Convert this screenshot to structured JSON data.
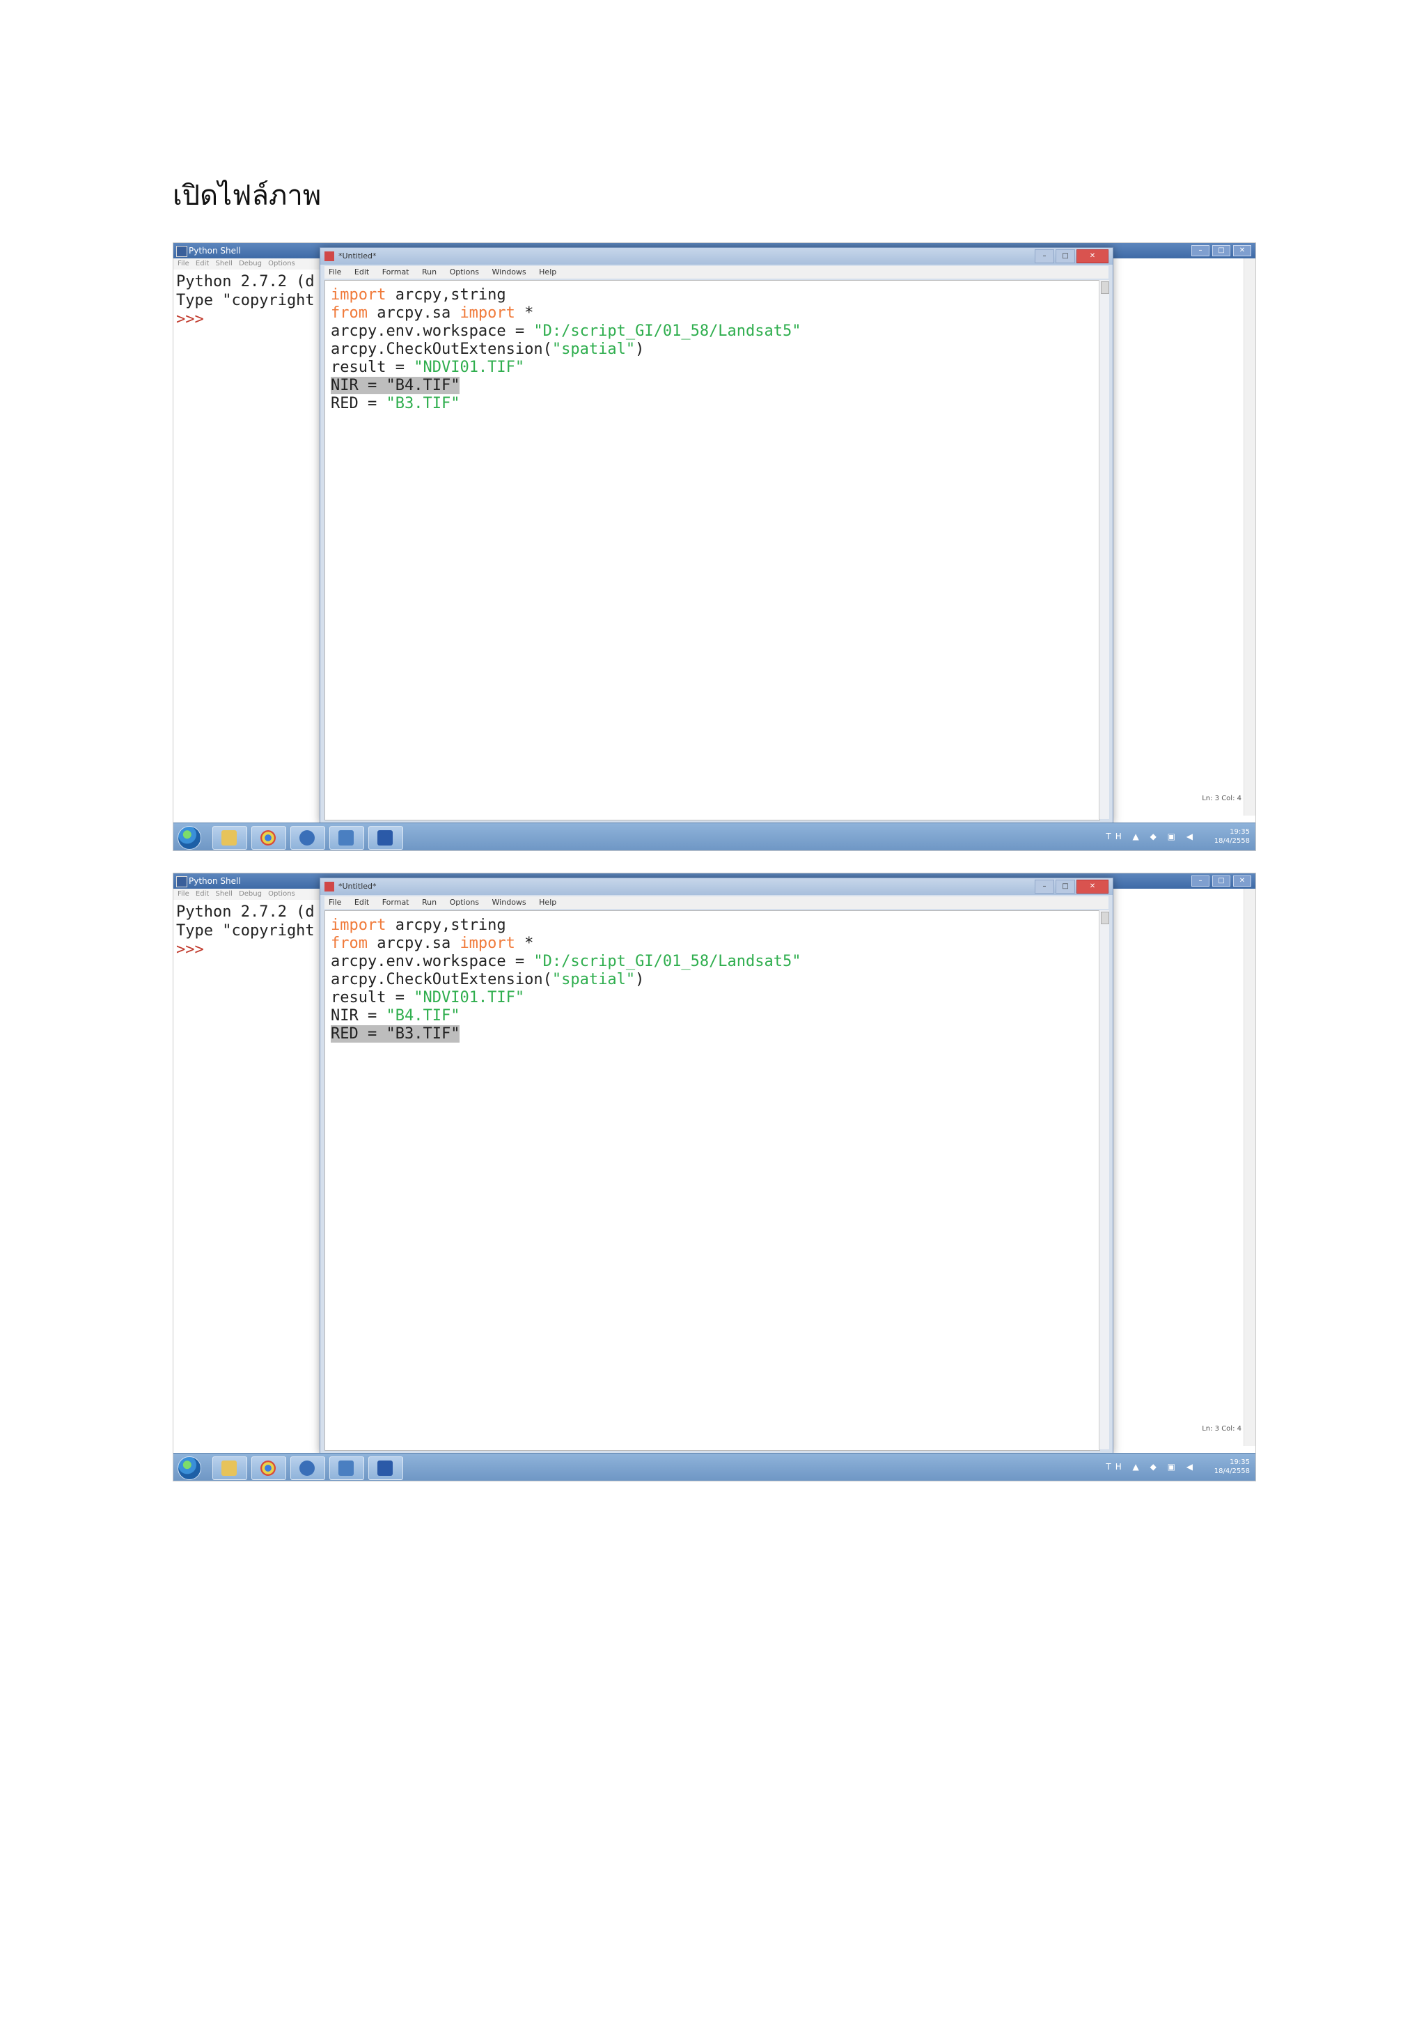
{
  "heading": "เปิดไฟล์ภาพ",
  "shell": {
    "title": "Python Shell",
    "menu": [
      "File",
      "Edit",
      "Shell",
      "Debug",
      "Options"
    ],
    "lines": [
      "Python 2.7.2 (d",
      "Type \"copyright"
    ],
    "prompt": ">>>",
    "status": "Ln: 3 Col: 4"
  },
  "editor": {
    "title": "*Untitled*",
    "menu": [
      "File",
      "Edit",
      "Format",
      "Run",
      "Options",
      "Windows",
      "Help"
    ],
    "code": {
      "l1_kw": "import",
      "l1_rest": " arcpy,string",
      "l2_kw1": "from",
      "l2_mid": " arcpy.sa ",
      "l2_kw2": "import",
      "l2_rest": " *",
      "l3_pre": "arcpy.env.workspace = ",
      "l3_str": "\"D:/script_GI/01_58/Landsat5\"",
      "l4_pre": "arcpy.CheckOutExtension(",
      "l4_str": "\"spatial\"",
      "l4_post": ")",
      "l5_pre": "result = ",
      "l5_str": "\"NDVI01.TIF\"",
      "l6_pre": "NIR = ",
      "l6_str": "\"B4.TIF\"",
      "l7_pre": "RED = ",
      "l7_str": "\"B3.TIF\""
    }
  },
  "taskbar": {
    "clock_time": "19:35",
    "clock_date": "18/4/2558",
    "lang": "TH"
  },
  "colors": {
    "keyword": "#f07a3a",
    "string": "#2fae4e",
    "highlight": "#bdbdbd",
    "taskbar": "#8fb3da"
  }
}
